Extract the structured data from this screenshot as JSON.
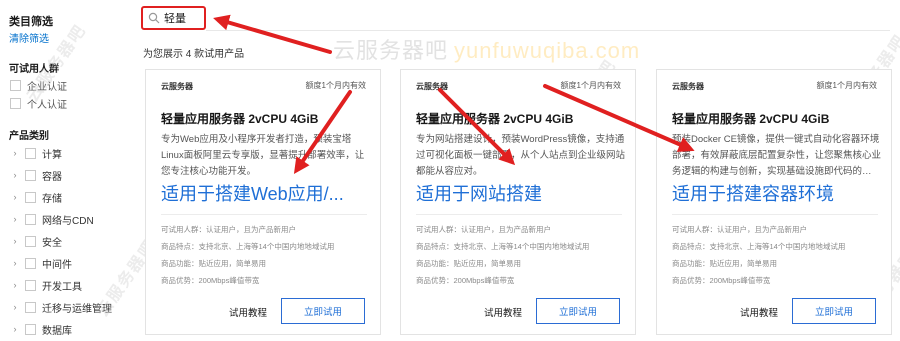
{
  "sidebar": {
    "title": "类目筛选",
    "clear_label": "清除筛选",
    "trial_section": "可试用人群",
    "trial_options": [
      "企业认证",
      "个人认证"
    ],
    "category_section": "产品类别",
    "categories": [
      "计算",
      "容器",
      "存储",
      "网络与CDN",
      "安全",
      "中间件",
      "开发工具",
      "迁移与运维管理",
      "数据库"
    ]
  },
  "search": {
    "icon": "search-icon",
    "value": "轻量"
  },
  "results": {
    "count_text": "为您展示 4 款试用产品"
  },
  "watermark": {
    "text": "云服务器吧",
    "url": "yunfuwuqiba.com",
    "diag": "云服务器吧"
  },
  "cards": [
    {
      "header": "云服务器",
      "quota": "额度1个月内有效",
      "title": "轻量应用服务器 2vCPU 4GiB",
      "description": "专为Web应用及小程序开发者打造，预装宝塔Linux面板阿里云专享版，显著提升部署效率，让您专注核心功能开发。",
      "highlight": "适用于搭建Web应用/...",
      "info": [
        "可试用人群：认证用户，且为产品新用户",
        "商品特点：支持北京、上海等14个中国内地地域试用",
        "商品功能：贴近应用，简单易用",
        "商品优势：200Mbps峰值带宽"
      ],
      "tutorial_label": "试用教程",
      "trial_button": "立即试用"
    },
    {
      "header": "云服务器",
      "quota": "额度1个月内有效",
      "title": "轻量应用服务器 2vCPU 4GiB",
      "description": "专为网站搭建设计，预装WordPress镜像，支持通过可视化面板一键部署，从个人站点到企业级网站都能从容应对。",
      "highlight": "适用于网站搭建",
      "info": [
        "可试用人群：认证用户，且为产品新用户",
        "商品特点：支持北京、上海等14个中国内地地域试用",
        "商品功能：贴近应用，简单易用",
        "商品优势：200Mbps峰值带宽"
      ],
      "tutorial_label": "试用教程",
      "trial_button": "立即试用"
    },
    {
      "header": "云服务器",
      "quota": "额度1个月内有效",
      "title": "轻量应用服务器 2vCPU 4GiB",
      "description": "预装Docker CE镜像，提供一键式自动化容器环境部署，有效屏蔽底层配置复杂性，让您聚焦核心业务逻辑的构建与创新，实现基础设施即代码的…",
      "highlight": "适用于搭建容器环境",
      "info": [
        "可试用人群：认证用户，且为产品新用户",
        "商品特点：支持北京、上海等14个中国内地地域试用",
        "商品功能：贴近应用，简单易用",
        "商品优势：200Mbps峰值带宽"
      ],
      "tutorial_label": "试用教程",
      "trial_button": "立即试用"
    }
  ],
  "annotation": {
    "arrow_color": "#e02020"
  }
}
